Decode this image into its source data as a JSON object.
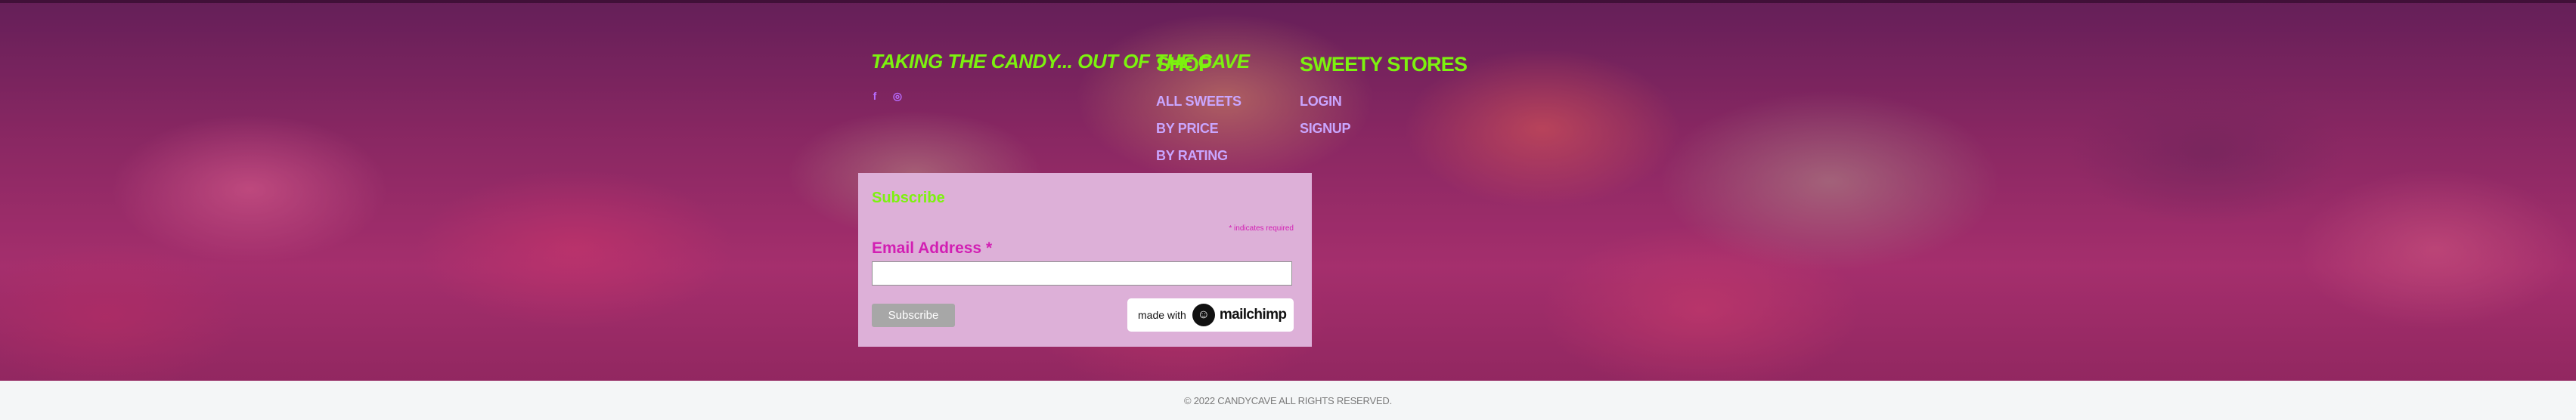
{
  "brand": {
    "tagline": "TAKING THE CANDY... OUT OF THE CAVE"
  },
  "social": {
    "icons": [
      "facebook-icon",
      "instagram-icon"
    ],
    "glyphs": [
      "f",
      "◎"
    ]
  },
  "shop": {
    "title": "SHOP",
    "links": [
      "ALL SWEETS",
      "BY PRICE",
      "BY RATING"
    ]
  },
  "stories": {
    "title": "SWEETY STORES",
    "links": [
      "LOGIN",
      "SIGNUP"
    ]
  },
  "subscribe_form": {
    "title": "Subscribe",
    "required_note": "* indicates required",
    "email_label": "Email Address",
    "required_mark": "*",
    "email_value": "",
    "button_label": "Subscribe",
    "badge_prefix": "made with",
    "badge_brand": "mailchimp"
  },
  "footer": {
    "copyright": "© 2022 CANDYCAVE ALL RIGHTS RESERVED."
  },
  "colors": {
    "accent_green": "#7cf20f",
    "link_lilac": "#c9a6ff",
    "form_bg": "#ddb0d8",
    "required_pink": "#d21fb3"
  }
}
